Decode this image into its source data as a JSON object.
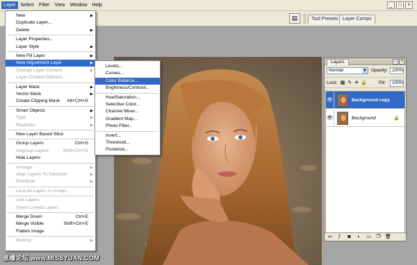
{
  "menubar": {
    "items": [
      "Layer",
      "Select",
      "Filter",
      "View",
      "Window",
      "Help"
    ],
    "active_index": 0
  },
  "window_buttons": [
    "_",
    "□",
    "×"
  ],
  "options_bar": {
    "tool_icon": "palette-well-icon",
    "tabs": [
      "Tool Presets",
      "Layer Comps"
    ]
  },
  "layer_menu": {
    "items": [
      {
        "label": "New",
        "sub": true
      },
      {
        "label": "Duplicate Layer..."
      },
      {
        "label": "Delete",
        "sub": true
      },
      {
        "sep": true
      },
      {
        "label": "Layer Properties..."
      },
      {
        "label": "Layer Style",
        "sub": true
      },
      {
        "sep": true
      },
      {
        "label": "New Fill Layer",
        "sub": true
      },
      {
        "label": "New Adjustment Layer",
        "sub": true,
        "hl": true
      },
      {
        "label": "Change Layer Content",
        "sub": true,
        "dis": true
      },
      {
        "label": "Layer Content Options...",
        "dis": true
      },
      {
        "sep": true
      },
      {
        "label": "Layer Mask",
        "sub": true
      },
      {
        "label": "Vector Mask",
        "sub": true
      },
      {
        "label": "Create Clipping Mask",
        "shortcut": "Alt+Ctrl+G"
      },
      {
        "sep": true
      },
      {
        "label": "Smart Objects",
        "sub": true
      },
      {
        "label": "Type",
        "sub": true,
        "dis": true
      },
      {
        "label": "Rasterize",
        "sub": true,
        "dis": true
      },
      {
        "sep": true
      },
      {
        "label": "New Layer Based Slice"
      },
      {
        "sep": true
      },
      {
        "label": "Group Layers",
        "shortcut": "Ctrl+G"
      },
      {
        "label": "Ungroup Layers",
        "shortcut": "Shift+Ctrl+G",
        "dis": true
      },
      {
        "label": "Hide Layers"
      },
      {
        "sep": true
      },
      {
        "label": "Arrange",
        "sub": true,
        "dis": true
      },
      {
        "label": "Align Layers To Selection",
        "sub": true,
        "dis": true
      },
      {
        "label": "Distribute",
        "sub": true,
        "dis": true
      },
      {
        "sep": true
      },
      {
        "label": "Lock All Layers in Group...",
        "dis": true
      },
      {
        "sep": true
      },
      {
        "label": "Link Layers",
        "dis": true
      },
      {
        "label": "Select Linked Layers",
        "dis": true
      },
      {
        "sep": true
      },
      {
        "label": "Merge Down",
        "shortcut": "Ctrl+E"
      },
      {
        "label": "Merge Visible",
        "shortcut": "Shift+Ctrl+E"
      },
      {
        "label": "Flatten Image"
      },
      {
        "sep": true
      },
      {
        "label": "Matting",
        "sub": true,
        "dis": true
      }
    ]
  },
  "adjustment_submenu": {
    "items": [
      {
        "label": "Levels..."
      },
      {
        "label": "Curves..."
      },
      {
        "label": "Color Balance...",
        "hl": true
      },
      {
        "label": "Brightness/Contrast..."
      },
      {
        "sep": true
      },
      {
        "label": "Hue/Saturation..."
      },
      {
        "label": "Selective Color..."
      },
      {
        "label": "Channel Mixer..."
      },
      {
        "label": "Gradient Map..."
      },
      {
        "label": "Photo Filter..."
      },
      {
        "sep": true
      },
      {
        "label": "Invert..."
      },
      {
        "label": "Threshold..."
      },
      {
        "label": "Posterize..."
      }
    ]
  },
  "layers_panel": {
    "tab": "Layers",
    "blend_mode": "Normal",
    "opacity_label": "Opacity:",
    "opacity_value": "100%",
    "lock_label": "Lock:",
    "fill_label": "Fill:",
    "fill_value": "100%",
    "layers": [
      {
        "name": "Background copy",
        "selected": true,
        "italic": false,
        "locked": false
      },
      {
        "name": "Background",
        "selected": false,
        "italic": true,
        "locked": true
      }
    ],
    "bottom_icons": [
      "link-icon",
      "fx-icon",
      "mask-icon",
      "adjustment-icon",
      "folder-icon",
      "new-layer-icon",
      "trash-icon"
    ]
  },
  "watermark": "思缘论坛 www.MISSYUAN.COM",
  "colors": {
    "menu_highlight": "#316ac5",
    "chrome": "#ece9d8",
    "workspace": "#a5a5a5"
  }
}
